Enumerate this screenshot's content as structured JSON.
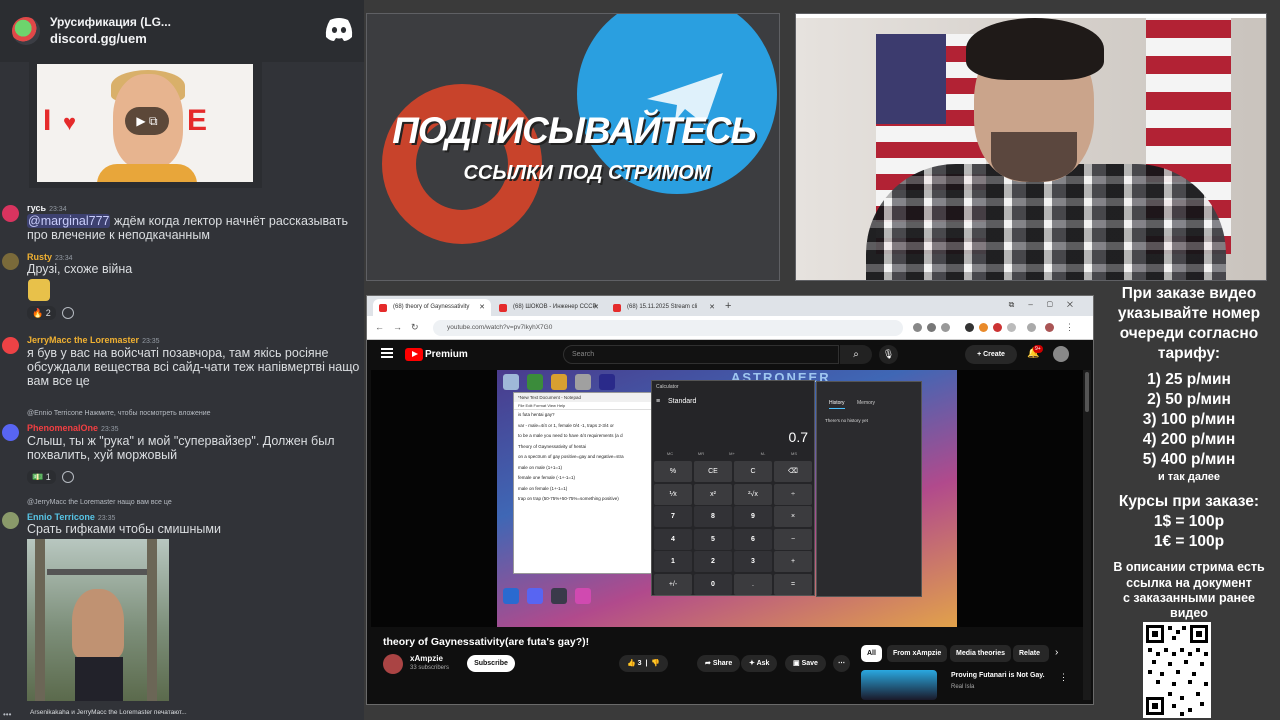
{
  "discord": {
    "server_title": "Урусификация (LG...",
    "invite_link": "discord.gg/uem",
    "messages": [
      {
        "user": "гусь",
        "time": "23:34",
        "mention": "@marginal777",
        "text": " ждём когда лектор начнёт рассказывать про влечение к неподкачанным"
      },
      {
        "user": "Rusty",
        "time": "23:34",
        "text": "Друзі, схоже війна",
        "reaction_count": "2"
      },
      {
        "user": "JerryMacc the Loremaster",
        "time": "23:35",
        "text": "я був у вас на войсчаті позавчора, там якісь росіяне обсуждали вещества всі сайд-чати теж напівмертві нащо вам все це"
      },
      {
        "reply": "@Ennio Terricone  Нажмите, чтобы посмотреть вложение",
        "user": "PhenomenalOne",
        "time": "23:35",
        "text": "Слыш, ты ж \"рука\" и мой \"супервайзер\". Должен был похвалить, хуй моржовый",
        "reaction_count": "1"
      },
      {
        "reply": "@JerryMacc the Loremaster нащо вам все це",
        "user": "Ennio Terricone",
        "time": "23:35",
        "text": "Срать гифками чтобы смишными"
      }
    ],
    "typing": "Arsenikakaha и JerryMacc the Loremaster печатают..."
  },
  "promo": {
    "title": "ПОДПИСЫВАЙТЕСЬ",
    "subtitle": "ССЫЛКИ ПОД СТРИМОМ"
  },
  "info": {
    "intro": [
      "При заказе видео",
      "указывайте номер",
      "очереди согласно",
      "тарифу:"
    ],
    "tariffs": [
      "1) 25 р/мин",
      "2) 50 р/мин",
      "3) 100 р/мин",
      "4) 200 р/мин",
      "5) 400 р/мин"
    ],
    "etc": "и так далее",
    "rates_title": "Курсы при заказе:",
    "rates": [
      "1$ = 100р",
      "1€ = 100р"
    ],
    "outro": [
      "В описании стрима есть",
      "ссылка на документ",
      "с заказанными ранее",
      "видео"
    ]
  },
  "browser": {
    "tabs": [
      "(68) theory of Gaynessativity",
      "(68) ШОКОВ - Инженер CCCP",
      "(68) 15.11.2025 Stream cli"
    ],
    "url": "youtube.com/watch?v=pv7lkyhX7G0",
    "youtube": {
      "brand": "Premium",
      "search_placeholder": "Search",
      "create_label": "Create",
      "notif_count": "9+",
      "video_title": "theory of Gaynessativity(are futa's gay?)!",
      "channel": "xAmpzie",
      "subscribers": "33 subscribers",
      "subscribe_label": "Subscribe",
      "likes": "3",
      "share_label": "Share",
      "ask_label": "Ask",
      "save_label": "Save",
      "chips": [
        "All",
        "From xAmpzie",
        "Media theories",
        "Relate"
      ],
      "rec_title": "Proving Futanari is Not Gay.",
      "rec_channel": "Real Isla",
      "game_title": "ASTRONEER"
    },
    "notepad": {
      "title": "*New Text Document - Notepad",
      "menu": "File  Edit  Format  View  Help",
      "lines": [
        "is futa hentai gay?",
        "var - male=4/4 or 1, female 0/4 -1, traps 2-3/4 or",
        "to be a male you need to have 4/4 requirements (a d",
        "Theory of Gaynessativity of hentai",
        "on a spectrum of gay positive=gay and negative=stra",
        "male on male (1+1=1)",
        "female one female (-1+-1=1)",
        "male on female (1+-1=1)",
        "trap on trap (50-75%+50-75%=something positive)"
      ]
    },
    "calculator": {
      "title": "Calculator",
      "mode": "Standard",
      "display": "0.7",
      "history_tab": "History",
      "memory_tab": "Memory",
      "history_empty": "There's no history yet",
      "memory_keys": [
        "MC",
        "MR",
        "M+",
        "M-",
        "MS"
      ],
      "keys": [
        "%",
        "CE",
        "C",
        "⌫",
        "⅟x",
        "x²",
        "²√x",
        "÷",
        "7",
        "8",
        "9",
        "×",
        "4",
        "5",
        "6",
        "−",
        "1",
        "2",
        "3",
        "+",
        "+/-",
        "0",
        ".",
        "="
      ]
    }
  }
}
